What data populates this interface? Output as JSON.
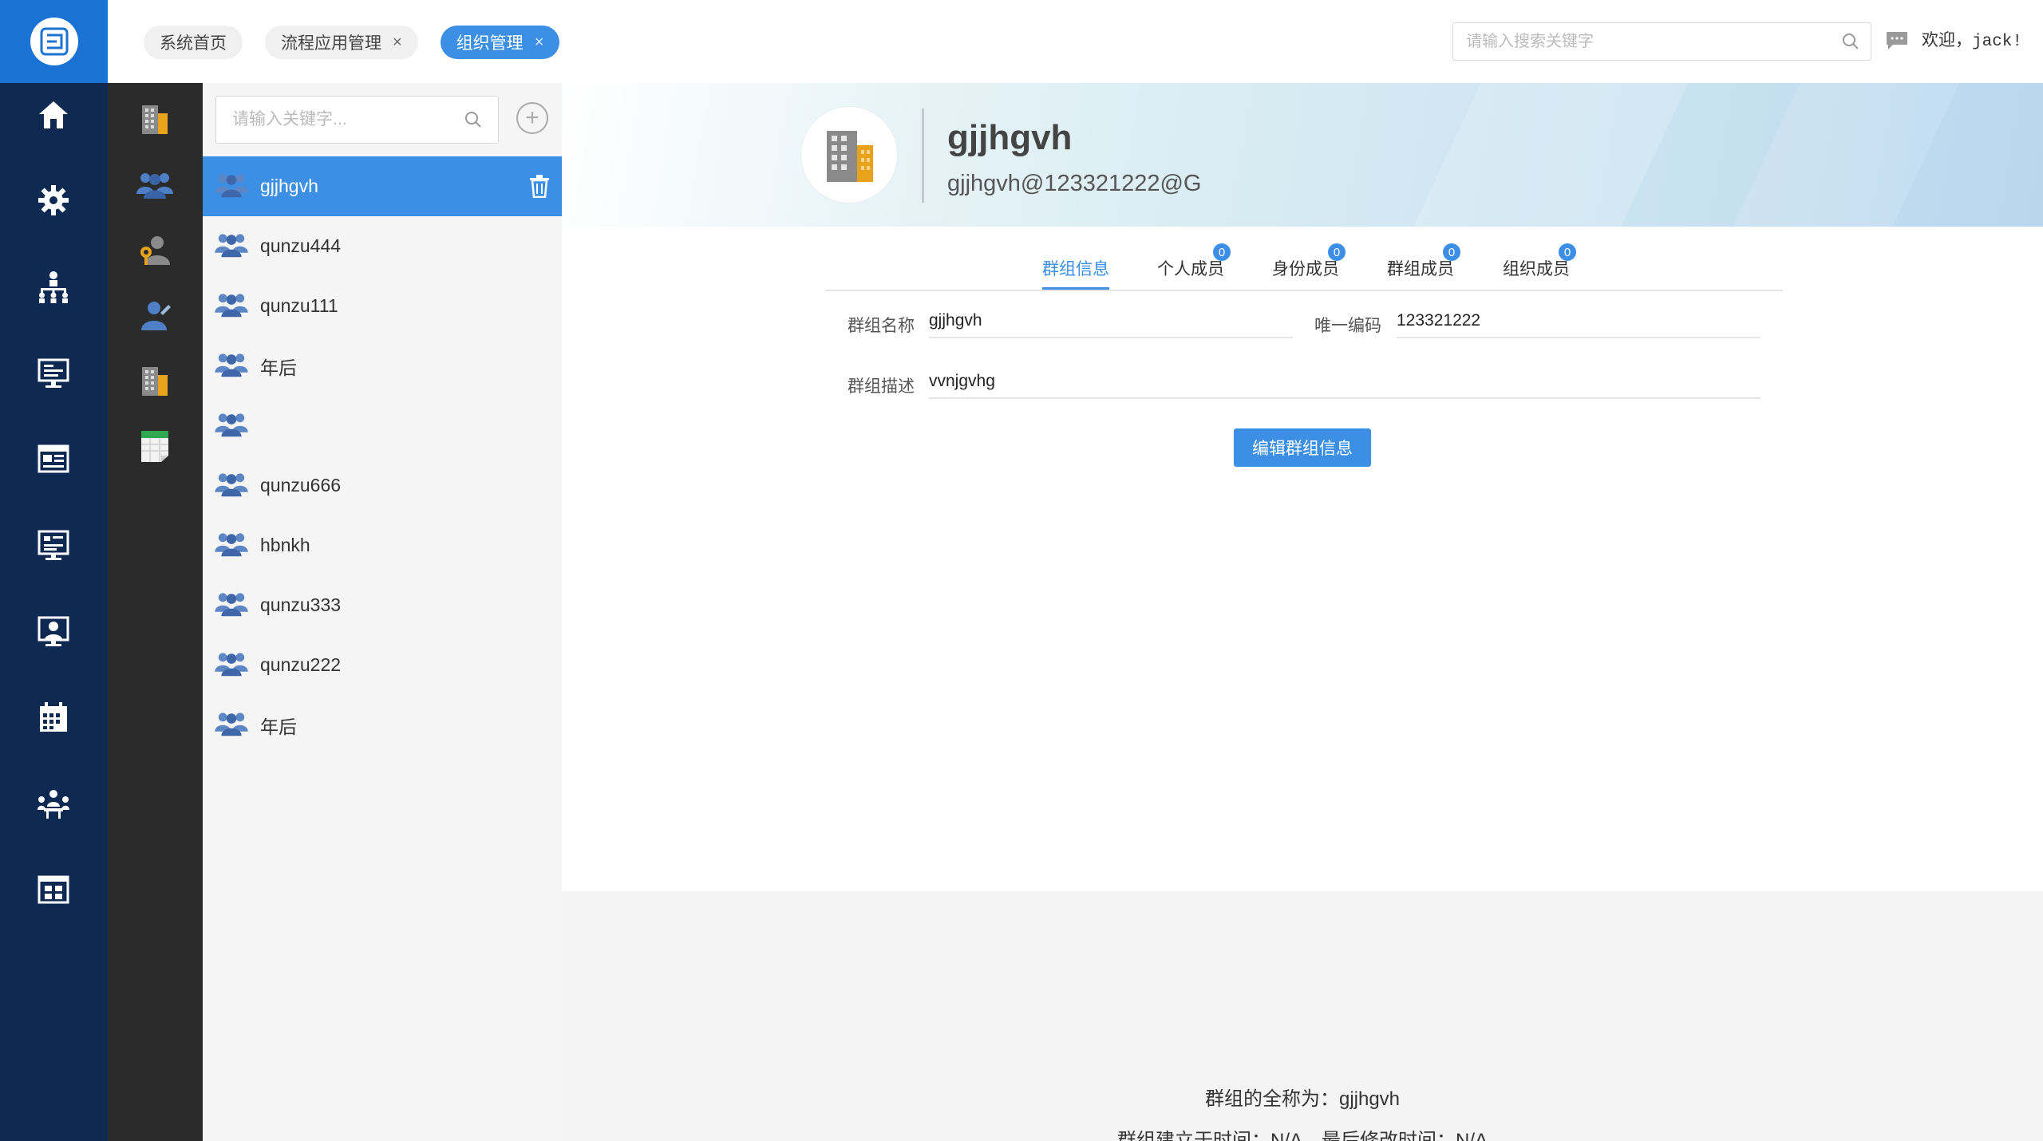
{
  "header": {
    "tabs": [
      {
        "label": "系统首页",
        "closable": false,
        "active": false
      },
      {
        "label": "流程应用管理",
        "closable": true,
        "active": false
      },
      {
        "label": "组织管理",
        "closable": true,
        "active": true
      }
    ],
    "close_glyph": "×",
    "search_placeholder": "请输入搜索关键字",
    "welcome": "欢迎，jack!"
  },
  "nav": {
    "main_icons": [
      "home-icon",
      "gear-icon",
      "org-chart-icon",
      "monitor-icon",
      "news-icon",
      "dashboard-icon",
      "presentation-icon",
      "calendar-icon",
      "meeting-icon",
      "grid-icon"
    ],
    "sub_icons": [
      "building-icon",
      "group-icon",
      "role-user-icon",
      "person-edit-icon",
      "building-icon",
      "spreadsheet-icon"
    ]
  },
  "group_list": {
    "search_placeholder": "请输入关键字...",
    "add_glyph": "+",
    "items": [
      {
        "label": "gjjhgvh",
        "selected": true
      },
      {
        "label": "qunzu444",
        "selected": false
      },
      {
        "label": "qunzu111",
        "selected": false
      },
      {
        "label": "年后",
        "selected": false
      },
      {
        "label": "",
        "selected": false
      },
      {
        "label": "qunzu666",
        "selected": false
      },
      {
        "label": "hbnkh",
        "selected": false
      },
      {
        "label": "qunzu333",
        "selected": false
      },
      {
        "label": "qunzu222",
        "selected": false
      },
      {
        "label": "年后",
        "selected": false
      }
    ]
  },
  "group": {
    "title": "gjjhgvh",
    "subtitle": "gjjhgvh@123321222@G"
  },
  "info_tabs": [
    {
      "label": "群组信息",
      "badge": null,
      "active": true
    },
    {
      "label": "个人成员",
      "badge": "0",
      "active": false
    },
    {
      "label": "身份成员",
      "badge": "0",
      "active": false
    },
    {
      "label": "群组成员",
      "badge": "0",
      "active": false
    },
    {
      "label": "组织成员",
      "badge": "0",
      "active": false
    }
  ],
  "form": {
    "name_label": "群组名称",
    "name_value": "gjjhgvh",
    "code_label": "唯一编码",
    "code_value": "123321222",
    "desc_label": "群组描述",
    "desc_value": "vvnjgvhg",
    "edit_button": "编辑群组信息"
  },
  "footer": {
    "line1": "群组的全称为：gjjhgvh",
    "line2": "群组建立于时间：N/A，最后修改时间：N/A"
  },
  "colors": {
    "accent": "#3d8fe6",
    "nav_bg": "#0f2a52",
    "subnav_bg": "#2b2b2b",
    "logo_bg": "#1a73d4"
  }
}
